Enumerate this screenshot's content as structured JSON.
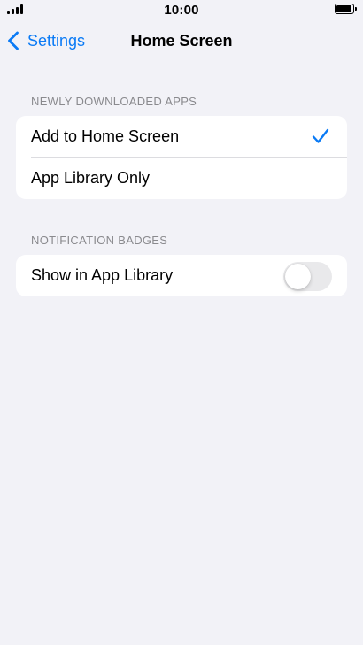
{
  "status_bar": {
    "time": "10:00",
    "signal_icon": "cellular-signal-icon",
    "battery_icon": "battery-full-icon"
  },
  "nav": {
    "back_label": "Settings",
    "back_icon": "chevron-left-icon",
    "title": "Home Screen"
  },
  "sections": {
    "newly_downloaded": {
      "header": "NEWLY DOWNLOADED APPS",
      "options": [
        {
          "label": "Add to Home Screen",
          "selected": true
        },
        {
          "label": "App Library Only",
          "selected": false
        }
      ]
    },
    "notification_badges": {
      "header": "NOTIFICATION BADGES",
      "show_in_app_library": {
        "label": "Show in App Library",
        "enabled": false
      }
    }
  },
  "colors": {
    "accent": "#0a7af5",
    "background": "#f2f2f7",
    "secondary_text": "#8a8a8e",
    "toggle_off": "#e9e9eb"
  }
}
